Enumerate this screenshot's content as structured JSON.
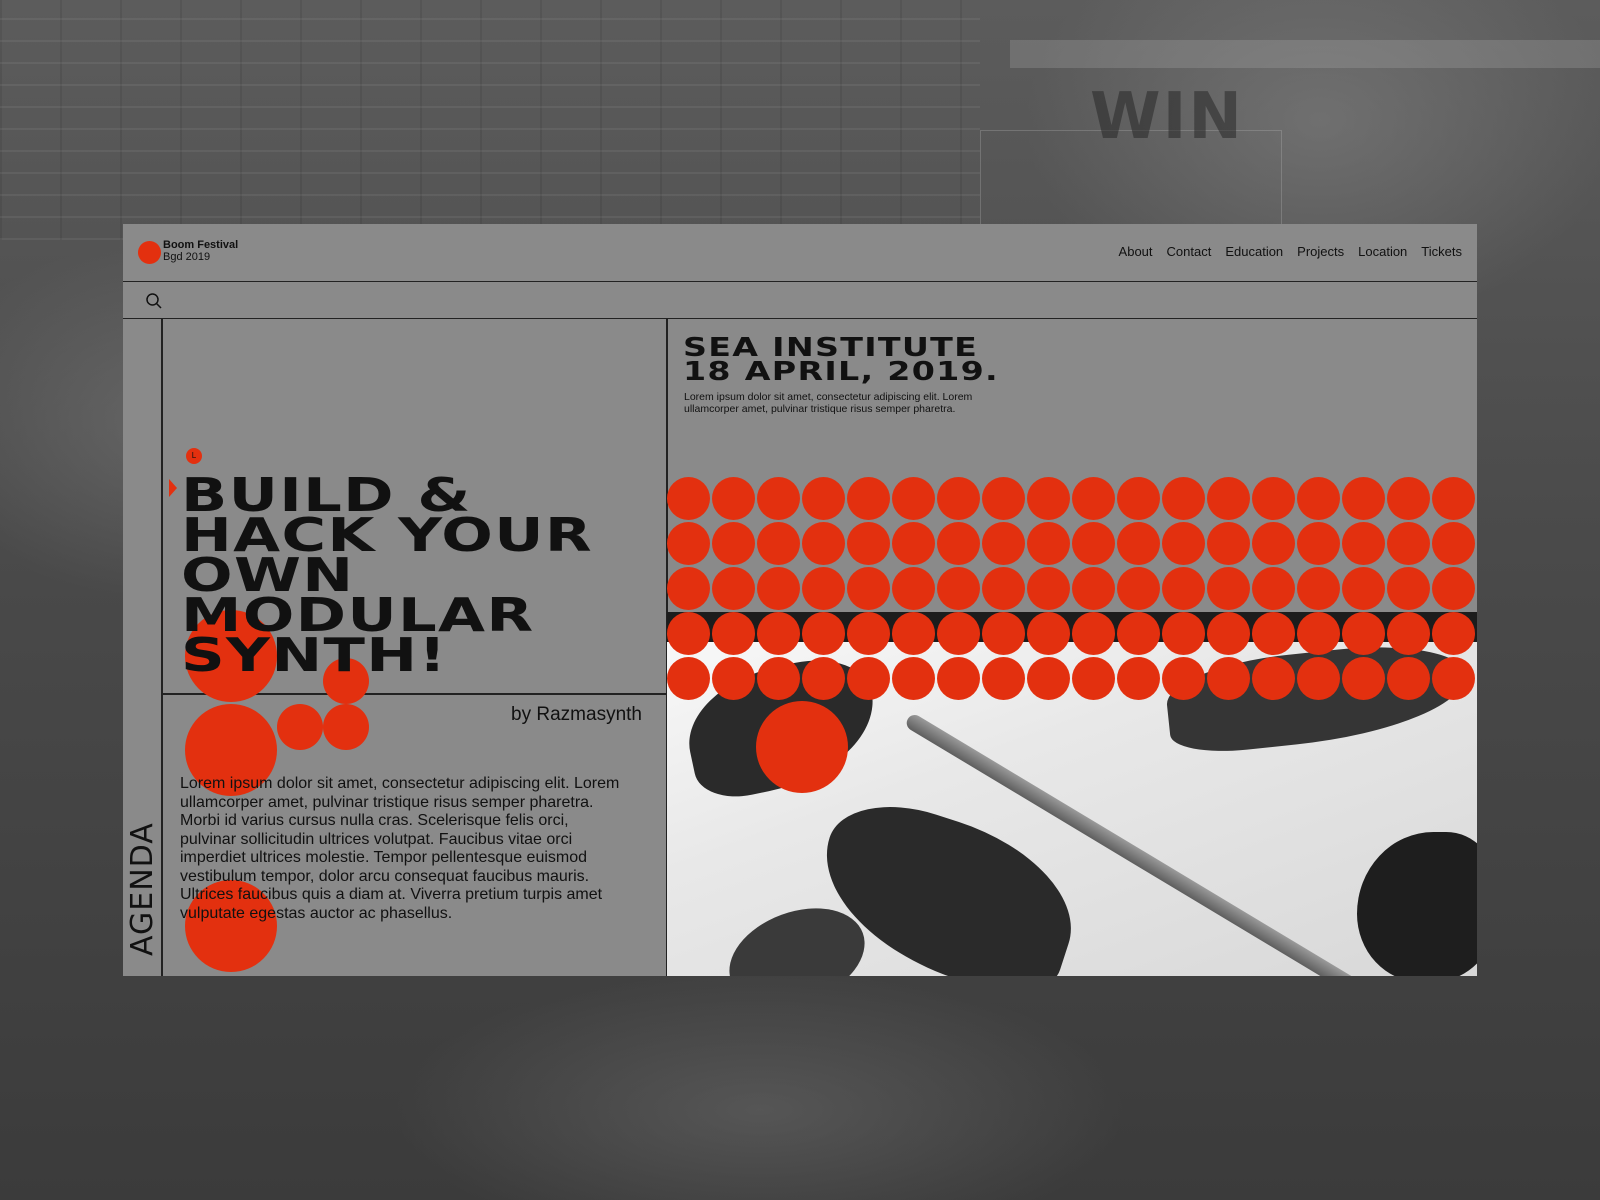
{
  "brand": {
    "name": "Boom Festival",
    "subtitle": "Bgd 2019"
  },
  "nav": {
    "items": [
      "About",
      "Contact",
      "Education",
      "Projects",
      "Location",
      "Tickets"
    ]
  },
  "search": {
    "icon": "search-icon"
  },
  "sidebar": {
    "label": "AGENDA"
  },
  "hero": {
    "marker": "L",
    "headline": "BUILD &\nHACK YOUR\nOWN\nMODULAR\nSYNTH!",
    "byline": "by Razmasynth",
    "body": "Lorem ipsum dolor sit amet, consectetur adipiscing elit. Lorem ullamcorper amet, pulvinar tristique risus semper pharetra. Morbi id varius cursus nulla cras. Scelerisque felis orci, pulvinar sollicitudin ultrices volutpat. Faucibus vitae orci imperdiet ultrices molestie. Tempor pellentesque euismod vestibulum tempor, dolor arcu consequat faucibus mauris. Ultrices faucibus quis a diam at. Viverra pretium turpis amet vulputate egestas auctor ac phasellus."
  },
  "event": {
    "title_line1": "SEA INSTITUTE",
    "title_line2": "18 APRIL, 2019.",
    "description": "Lorem ipsum dolor sit amet, consectetur adipiscing elit. Lorem ullamcorper amet, pulvinar tristique risus semper pharetra."
  },
  "background": {
    "sign_text": "WIN"
  },
  "colors": {
    "accent": "#e3300f",
    "panel": "#8a8a8a",
    "ink": "#111111"
  }
}
